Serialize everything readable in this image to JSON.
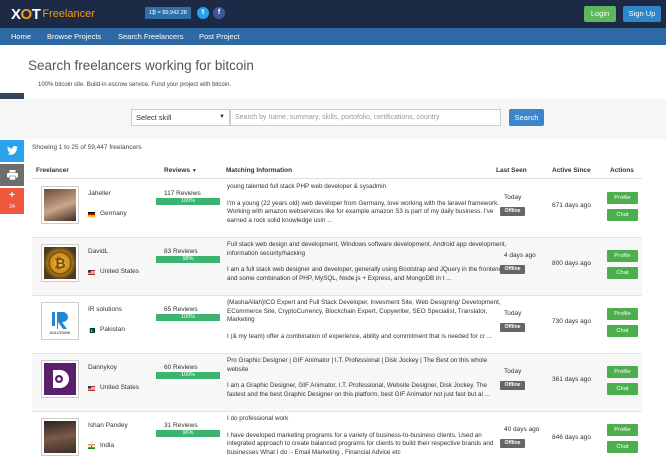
{
  "header": {
    "logo_mark_pre": "X",
    "logo_mark_o": "O",
    "logo_mark_post": "T",
    "logo_text": "Freelancer",
    "rate": "1₿ = $9,942.28",
    "login": "Login",
    "signup": "Sign Up"
  },
  "nav": [
    "Home",
    "Browse Projects",
    "Search Freelancers",
    "Post Project"
  ],
  "share": {
    "count": "24"
  },
  "page": {
    "title": "Search freelancers working for bitcoin",
    "subtitle": "100% bitcoin site. Build-in escrow service. Fund your project with bitcoin."
  },
  "search": {
    "skill_selected": "Select skill",
    "placeholder": "Search by name, summary, skills, portofolio, certifications, country",
    "button": "Search"
  },
  "showing": "Showing 1 to 25 of 59,447 freelancers",
  "columns": {
    "freelancer": "Freelancer",
    "reviews": "Reviews",
    "matching": "Matching Information",
    "last_seen": "Last Seen",
    "active_since": "Active Since",
    "actions": "Actions"
  },
  "rows": [
    {
      "name": "Jaheller",
      "country": "Germany",
      "reviews": "117 Reviews",
      "pct": "100%",
      "summary": "young talented full stack PHP web developer & sysadmin",
      "desc": "I'm a young (22 years old) web developer from Germany, love working with the laravel framework. Working with amazon webservices like for example amazon S3 is part of my daily business. I've earned a rock solid knowledge usin ...",
      "last_seen": "Today",
      "status": "Offline",
      "active": "671 days ago",
      "profile": "Profile",
      "chat": "Chat"
    },
    {
      "name": "DavidL",
      "country": "United States",
      "reviews": "83 Reviews",
      "pct": "98%",
      "summary": "Full stack web design and development, Windows software development, Android app development, information security/hacking",
      "desc": "I am a full stack web designer and developer, generally using Bootstrap and JQuery in the frontend and some combination of PHP, MySQL, Node.js + Express, and MongoDB in t ...",
      "last_seen": "4 days ago",
      "status": "Offline",
      "active": "800 days ago",
      "profile": "Profile",
      "chat": "Chat"
    },
    {
      "name": "IR solutions",
      "country": "Pakistan",
      "reviews": "65 Reviews",
      "pct": "100%",
      "summary": "{MashaAllah}ICO Expert and Full Stack Developer, Invesment Site, Web Designing/ Development, ECommerce Site, CryptoCurrency, Blockchain Expert, Copywriter, SEO Specialist, Translator, Marketing",
      "desc": "I (& my team) offer a combination of experience, ability and commitment that is needed for cr ...",
      "last_seen": "Today",
      "status": "Offline",
      "active": "730 days ago",
      "profile": "Profile",
      "chat": "Chat"
    },
    {
      "name": "Dannykoy",
      "country": "United States",
      "reviews": "60 Reviews",
      "pct": "100%",
      "summary": "Pro Graphic Designer | GIF Animator | I.T. Professional | Disk Jockey | The Best on this whole website",
      "desc": "I am a Graphic Designer, GIF Animator, I.T. Professional, Website Designer, Disk Jockey. The fastest and the best Graphic Designer on this platform, best GIF Animator not just fast but al ...",
      "last_seen": "Today",
      "status": "Offline",
      "active": "361 days ago",
      "profile": "Profile",
      "chat": "Chat"
    },
    {
      "name": "Ishan Pandey",
      "country": "India",
      "reviews": "31 Reviews",
      "pct": "96%",
      "summary": "I do professional work",
      "desc": "I have developed marketing programs for a variety of business-to-business clients. Used an integrated approach to create balanced programs for clients to build their respective brands and businesses What I do :- Email Marketing , Financial Advice etc",
      "last_seen": "40 days ago",
      "status": "Offline",
      "active": "846 days ago",
      "profile": "Profile",
      "chat": "Chat"
    }
  ]
}
